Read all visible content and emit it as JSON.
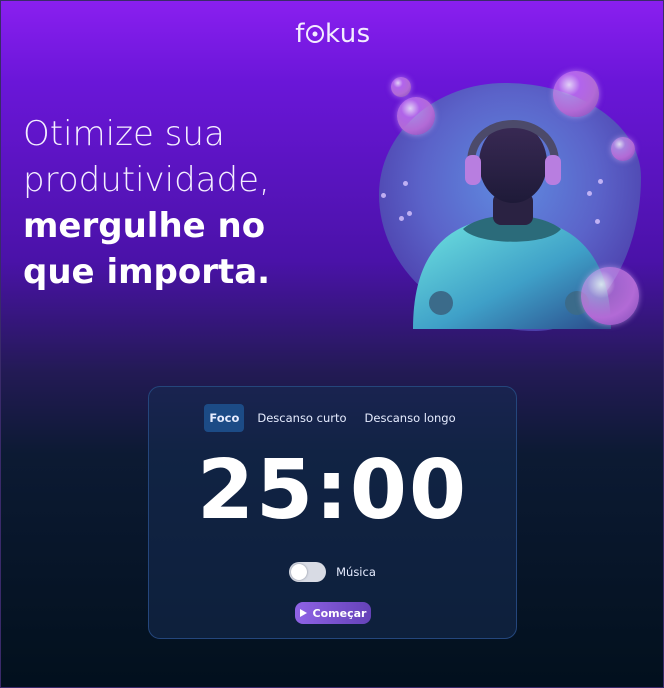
{
  "brand": {
    "logo_prefix": "f",
    "logo_suffix": "kus"
  },
  "headline": {
    "line1": "Otimize sua",
    "line2": "produtividade,",
    "line3": "mergulhe no",
    "line4": "que importa."
  },
  "timer": {
    "tabs": [
      {
        "label": "Foco",
        "active": true
      },
      {
        "label": "Descanso curto",
        "active": false
      },
      {
        "label": "Descanso longo",
        "active": false
      }
    ],
    "time": "25:00",
    "music_label": "Música",
    "music_on": false,
    "start_label": "Começar"
  },
  "colors": {
    "accent": "#8f63e6",
    "active_tab": "#1c4b86",
    "bg_top": "#8a1ff0",
    "bg_bottom": "#02101d"
  },
  "icons": {
    "logo_o": "target-circle-icon",
    "start": "play-icon"
  }
}
